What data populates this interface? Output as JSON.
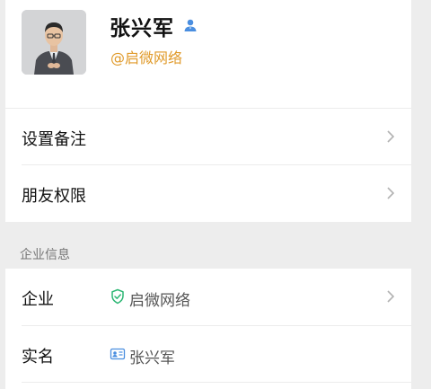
{
  "profile": {
    "name": "张兴军",
    "company_tag": "@启微网络",
    "verified_color": "#4a8ee0",
    "avatar_icon": "person-photo"
  },
  "settings": {
    "remark_label": "设置备注",
    "permissions_label": "朋友权限"
  },
  "enterprise": {
    "section_title": "企业信息",
    "company_label": "企业",
    "company_value": "启微网络",
    "company_icon": "shield-check-icon",
    "company_icon_color": "#2bb673",
    "realname_label": "实名",
    "realname_value": "张兴军",
    "realname_icon": "id-card-icon",
    "realname_icon_color": "#4a8ee0"
  },
  "colors": {
    "accent_orange": "#e09a2a",
    "background": "#ededed"
  }
}
